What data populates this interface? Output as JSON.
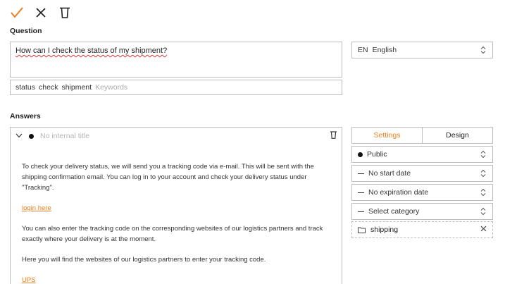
{
  "toolbar": {
    "save_icon": "check-icon",
    "close_icon": "close-icon",
    "delete_icon": "trash-icon",
    "accent_color": "#f07d1c"
  },
  "question": {
    "label": "Question",
    "text": "How can I check the status of my shipment?",
    "keywords": [
      "status",
      "check",
      "shipment"
    ],
    "keywords_placeholder": "Keywords"
  },
  "language": {
    "code": "EN",
    "name": "English"
  },
  "answers": {
    "label": "Answers",
    "title_placeholder": "No internal title",
    "paragraph_1": "To check your delivery status, we will send you a tracking code via e-mail. This will be sent with the shipping confirmation email. You can log in to your account and check your delivery status under \"Tracking\".",
    "link_1": "login here",
    "paragraph_2": "You can also enter the tracking code on the corresponding websites of our logistics partners and track exactly where your delivery is at the moment.",
    "paragraph_3": "Here you will find the websites of our logistics partners to enter your tracking code.",
    "link_2": "UPS"
  },
  "settings": {
    "tabs": [
      "Settings",
      "Design"
    ],
    "active_tab": "Settings",
    "visibility": "Public",
    "start_date": "No start date",
    "expiration_date": "No expiration date",
    "category_placeholder": "Select category",
    "category_value": "shipping"
  }
}
